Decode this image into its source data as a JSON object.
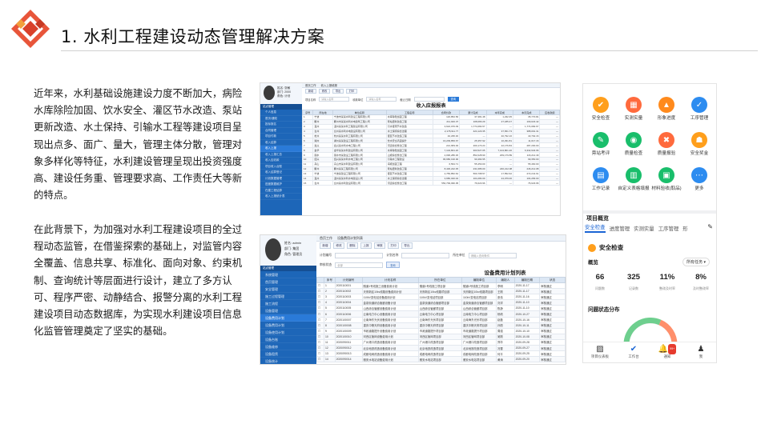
{
  "slide": {
    "title": "1. 水利工程建设动态管理解决方案",
    "paragraph_1": "近年来，水利基础设施建设力度不断加大，病险水库除险加固、饮水安全、灌区节水改造、泵站更新改造、水土保持、引输水工程等建设项目呈现出点多、面广、量大，管理主体分散，管理对象多样化等特征，水利建设管理呈现出投资强度高、建设任务重、管理要求高、工作责任大等新的特点。",
    "paragraph_2": "在此背景下，为加强对水利工程建设项目的全过程动态监管，在借鉴探索的基础上，对监管内容全覆盖、信息共享、标准化、面向对象、约束机制、查询统计等层面进行设计，建立了多方认可、程序严密、动静结合、报警分离的水利工程建设项目动态数据库，为实现水利建设项目信息化监管管理奠定了坚实的基础。"
  },
  "screenshot_income": {
    "user_name": "姓名: 张敏",
    "user_dept": "部门: 2000",
    "user_role": "角色: 计划",
    "sidebar_title": "站点管理",
    "sidebar_items": [
      "个人信息",
      "首页/通知",
      "投标报名",
      "合同管理",
      "项目付款",
      "收入结算",
      "收入上报",
      "收入上报汇总",
      "收入应收款",
      "项目收入台账",
      "收入结算登记",
      "计划数据管理",
      "进度数据维护",
      "在建工程结算",
      "收入上报统计表"
    ],
    "tabs": [
      "首页工作",
      "收入上报填报"
    ],
    "toolbar": [
      "新增",
      "修改",
      "导出",
      "打印"
    ],
    "filter_labels": [
      "项目名称",
      "收款单位",
      "截止日期"
    ],
    "filter_placeholder": "请输入名称",
    "search_label": "查询",
    "table_title": "收入应报报表",
    "columns": [
      "序号",
      "所在地",
      "单位名称",
      "工程名称",
      "合同价款",
      "累计完成",
      "本年完成",
      "本月完成",
      "应收款额"
    ],
    "rows": [
      [
        "1",
        "宁波",
        "宁波市某某水利建设工程有限公司",
        "水库除险加固工程",
        "120,852.56",
        "37,381.48",
        "1,232.35",
        "35,770.81",
        "—"
      ],
      [
        "2",
        "衢州",
        "衢州市某某水利水电建筑工程公司",
        "泵站更新改造工程",
        "211,940.37",
        "108,083.29",
        "27,185.47",
        "109,023.42",
        "—"
      ],
      [
        "3",
        "温州",
        "温州某某水利工程建设有限公司",
        "引水灌溉节水改造",
        "3,622,076.09",
        "1,774,082.67",
        "—",
        "1,774,082.67",
        "—"
      ],
      [
        "4",
        "台州",
        "台州某水利水电建设有限公司",
        "水土保持综合治理",
        "2,178,911.77",
        "424,120.35",
        "37,651.73",
        "388,091.31",
        "—"
      ],
      [
        "5",
        "杭州",
        "杭州某某水利工程有限公司",
        "灌区节水改造工程",
        "40,295.30",
        "—",
        "40,792.16",
        "40,792.16",
        "—"
      ],
      [
        "6",
        "湖州",
        "湖州某某建设工程有限公司",
        "饮水安全巩固提升",
        "16,209,856.67",
        "25,357.92",
        "10,291.81",
        "11,017.16",
        "—"
      ],
      [
        "7",
        "嘉兴",
        "嘉兴某水利水电工程公司",
        "河道综合整治工程",
        "221,683.94",
        "200,173.24",
        "22,176.84",
        "287,200.00",
        "—"
      ],
      [
        "8",
        "金华",
        "金华某某水利建设有限公司",
        "水库除险加固工程",
        "7,104,801.20",
        "303,527.05",
        "7,104,801.20",
        "6,332,934.96",
        "—"
      ],
      [
        "9",
        "丽水",
        "丽水市某建设工程有限公司",
        "山塘综合整治工程",
        "2,096,286.36",
        "852,028.90",
        "209,179.89",
        "116,212.49",
        "—"
      ],
      [
        "10",
        "绍兴",
        "绍兴某某水利水电工程公司",
        "引输水工程建设",
        "96,680,190.00",
        "90,482.95",
        "—",
        "99,350.00",
        "—"
      ],
      [
        "11",
        "舟山",
        "舟山市某水利建设有限公司",
        "海塘加固工程",
        "6,564.71",
        "55,450.00",
        "—",
        "55,460.00",
        "—"
      ],
      [
        "12",
        "衢州",
        "衢州某某工程有限公司",
        "泵站更新改造工程",
        "8,436,222.35",
        "231,686.00",
        "246,212.08",
        "246,212.08",
        "—"
      ],
      [
        "13",
        "宁波",
        "宁波某建设工程有限公司",
        "灌区节水改造工程",
        "2,783,852.62",
        "560,798.57",
        "17,552.62",
        "272,241.61",
        "—"
      ],
      [
        "14",
        "温州",
        "温州某某水利水电建设公司",
        "水土保持综合治理",
        "3,680,020.02",
        "104,284.00",
        "24,079.00",
        "104,283.00",
        "—"
      ],
      [
        "15",
        "台州",
        "台州某水利建设有限公司",
        "河道综合整治工程",
        "550,799,096.05",
        "76,623.96",
        "—",
        "76,623.96",
        "—"
      ]
    ]
  },
  "screenshot_plan": {
    "user_name": "姓名: admin",
    "user_dept": "部门: 集团",
    "user_role": "角色: 管理员",
    "sidebar_title": "站点管理",
    "sidebar_items": [
      "系统管理",
      "首页管理",
      "安全管理",
      "施工过程管理",
      "施工流程",
      "设备管理",
      "设备费用计划",
      "设备费用计划",
      "设备使用计划",
      "设备台账",
      "设备维修",
      "设备租赁",
      "设备统计",
      "设备报表"
    ],
    "tabs": [
      "首页工作",
      "设备费用计划列表"
    ],
    "toolbar": [
      "新增",
      "修改",
      "删除",
      "上报",
      "审核",
      "打印",
      "导出"
    ],
    "filter_labels": [
      "计划编号",
      "计划名称",
      "所在单位"
    ],
    "filter_placeholder": "请输入查询条件",
    "status_label": "审核状态",
    "status_value": "全部",
    "search_label": "查询",
    "table_title": "设备费用计划列表",
    "columns": [
      "",
      "序号",
      "计划编号",
      "计划名称",
      "所在单位",
      "编制单位",
      "编制人",
      "编制日期",
      "状态"
    ],
    "rows": [
      [
        "☐",
        "1",
        "2020110001",
        "隧道1号线施工设备费用计划",
        "隧道1号线施工项目部",
        "隧道1号线施工项目部",
        "李明",
        "2020-11-17",
        "审核通过"
      ],
      [
        "☐",
        "2",
        "2020110002",
        "天府新区10kv线路设备费用计划",
        "天府新区10kv线路项目部",
        "天府新区10kv线路项目部",
        "王刚",
        "2020-11-17",
        "审核通过"
      ],
      [
        "☐",
        "3",
        "2020110003",
        "110kV变电站设备费用计划",
        "110kV变电站项目部",
        "110kV变电站项目部",
        "张伟",
        "2020-11-16",
        "审核通过"
      ],
      [
        "☐",
        "4",
        "2020110004",
        "金泉街道综合管廊设备计划",
        "金泉街道综合管廊项目部",
        "金泉街道综合管廊项目部",
        "刘洋",
        "2020-11-10",
        "审核通过"
      ],
      [
        "☐",
        "5",
        "2020110005",
        "山西综合管廊设备费用计划",
        "山西综合管廊项目部",
        "山西综合管廊项目部",
        "陈静",
        "2020-11-10",
        "审核通过"
      ],
      [
        "☐",
        "6",
        "2020110006",
        "云南电力中心设备费用计划",
        "云南电力中心项目部",
        "云南电力中心项目部",
        "杨帆",
        "2020-10-27",
        "审核通过"
      ],
      [
        "☐",
        "7",
        "2020100007",
        "云南海东光伏设备费用计划",
        "云南海东光伏项目部",
        "云南海东光伏项目部",
        "赵磊",
        "2020-10-16",
        "审核通过"
      ],
      [
        "☐",
        "8",
        "2020100008",
        "重庆中粮天府设备费用计划",
        "重庆中粮天府项目部",
        "重庆中粮天府项目部",
        "孙丽",
        "2020-10-11",
        "审核通过"
      ],
      [
        "☐",
        "9",
        "2020100009",
        "市政道路提升设备费用计划",
        "市政道路提升项目部",
        "市政道路提升项目部",
        "周强",
        "2020-10-10",
        "审核通过"
      ],
      [
        "☐",
        "10",
        "2020100010",
        "河西区管网设备费用计划",
        "河西区管网项目部",
        "河西区管网项目部",
        "吴刚",
        "2020-10-08",
        "审核通过"
      ],
      [
        "☐",
        "11",
        "2020090011",
        "广州港口改造设备费用计划",
        "广州港口改造项目部",
        "广州港口改造项目部",
        "郑华",
        "2020-09-28",
        "审核通过"
      ],
      [
        "☐",
        "12",
        "2020090012",
        "北京地铁改造设备费用计划",
        "北京地铁改造项目部",
        "北京地铁改造项目部",
        "冯雪",
        "2020-09-27",
        "审核通过"
      ],
      [
        "☐",
        "13",
        "2020090013",
        "成都电网改造设备费用计划",
        "成都电网改造项目部",
        "成都电网改造项目部",
        "何平",
        "2020-09-25",
        "审核通过"
      ],
      [
        "☐",
        "14",
        "2020090014",
        "雅安水电站设备费用计划",
        "雅安水电站项目部",
        "雅安水电站项目部",
        "黄涛",
        "2020-09-20",
        "审核通过"
      ]
    ]
  },
  "mobile": {
    "grid": [
      {
        "label": "安全检查",
        "color": "#ff9f1c",
        "icon": "shield-check-icon",
        "glyph": "✔"
      },
      {
        "label": "实测实量",
        "color": "#ff6a3d",
        "icon": "ruler-icon",
        "glyph": "▦"
      },
      {
        "label": "形象进度",
        "color": "#ff8a1c",
        "icon": "progress-icon",
        "glyph": "▲"
      },
      {
        "label": "工序管理",
        "color": "#2d8cf0",
        "icon": "check-circle-icon",
        "glyph": "✓"
      },
      {
        "label": "旁站考评",
        "color": "#19be6b",
        "icon": "clipboard-icon",
        "glyph": "✎"
      },
      {
        "label": "质量检查",
        "color": "#19be6b",
        "icon": "quality-icon",
        "glyph": "◉"
      },
      {
        "label": "质量报验",
        "color": "#ff6a3d",
        "icon": "tools-icon",
        "glyph": "✖"
      },
      {
        "label": "安全奖金",
        "color": "#ff9f1c",
        "icon": "helmet-icon",
        "glyph": "☗"
      },
      {
        "label": "工作记录",
        "color": "#2d8cf0",
        "icon": "calendar-icon",
        "glyph": "▤"
      },
      {
        "label": "自定义表格填报",
        "color": "#19be6b",
        "icon": "form-icon",
        "glyph": "▥"
      },
      {
        "label": "材料验收(取品)",
        "color": "#19be6b",
        "icon": "box-icon",
        "glyph": "▣"
      },
      {
        "label": "更多",
        "color": "#2d8cf0",
        "icon": "more-icon",
        "glyph": "⋯"
      }
    ],
    "section_title": "项目概览",
    "tabs": [
      "安全检查",
      "进度管理",
      "实测实量",
      "工序管理",
      "形"
    ],
    "sub_title": "安全检查",
    "overview_label": "概览",
    "filter_label": "所有任务 ▾",
    "stats": [
      {
        "value": "66",
        "label": "问题数"
      },
      {
        "value": "325",
        "label": "记录数"
      },
      {
        "value": "11%",
        "label": "整改及时率"
      },
      {
        "value": "8%",
        "label": "及时整改率"
      }
    ],
    "dist_title": "问题状态分布",
    "nav": [
      {
        "label": "项目仪表板",
        "icon": "dashboard-icon",
        "glyph": "▨"
      },
      {
        "label": "工作台",
        "icon": "workbench-icon",
        "glyph": "✔"
      },
      {
        "label": "通知",
        "icon": "bell-icon",
        "glyph": "🔔"
      },
      {
        "label": "我",
        "icon": "user-icon",
        "glyph": "♟"
      }
    ],
    "notif_badge": "99+"
  }
}
